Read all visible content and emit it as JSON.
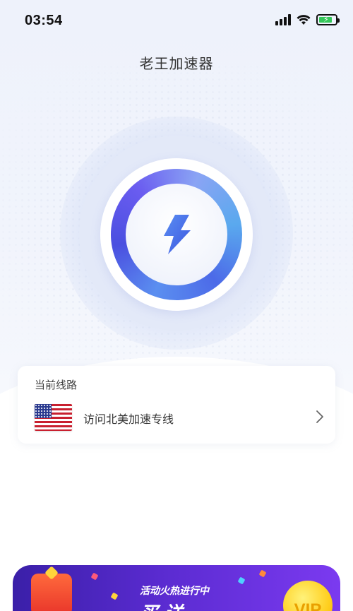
{
  "status_bar": {
    "time": "03:54"
  },
  "header": {
    "title": "老王加速器"
  },
  "accelerator": {
    "icon": "lightning-bolt-icon"
  },
  "route_card": {
    "label": "当前线路",
    "route_name": "访问北美加速专线",
    "flag": "us-flag-icon"
  },
  "promo": {
    "tagline": "活动火热进行中",
    "headline": "买  送",
    "badge": "VIP"
  },
  "colors": {
    "accent": "#4a5ae8",
    "ring_start": "#5b8ff0",
    "ring_end": "#4a4fe0",
    "promo_bg": "#5a2bd0"
  }
}
